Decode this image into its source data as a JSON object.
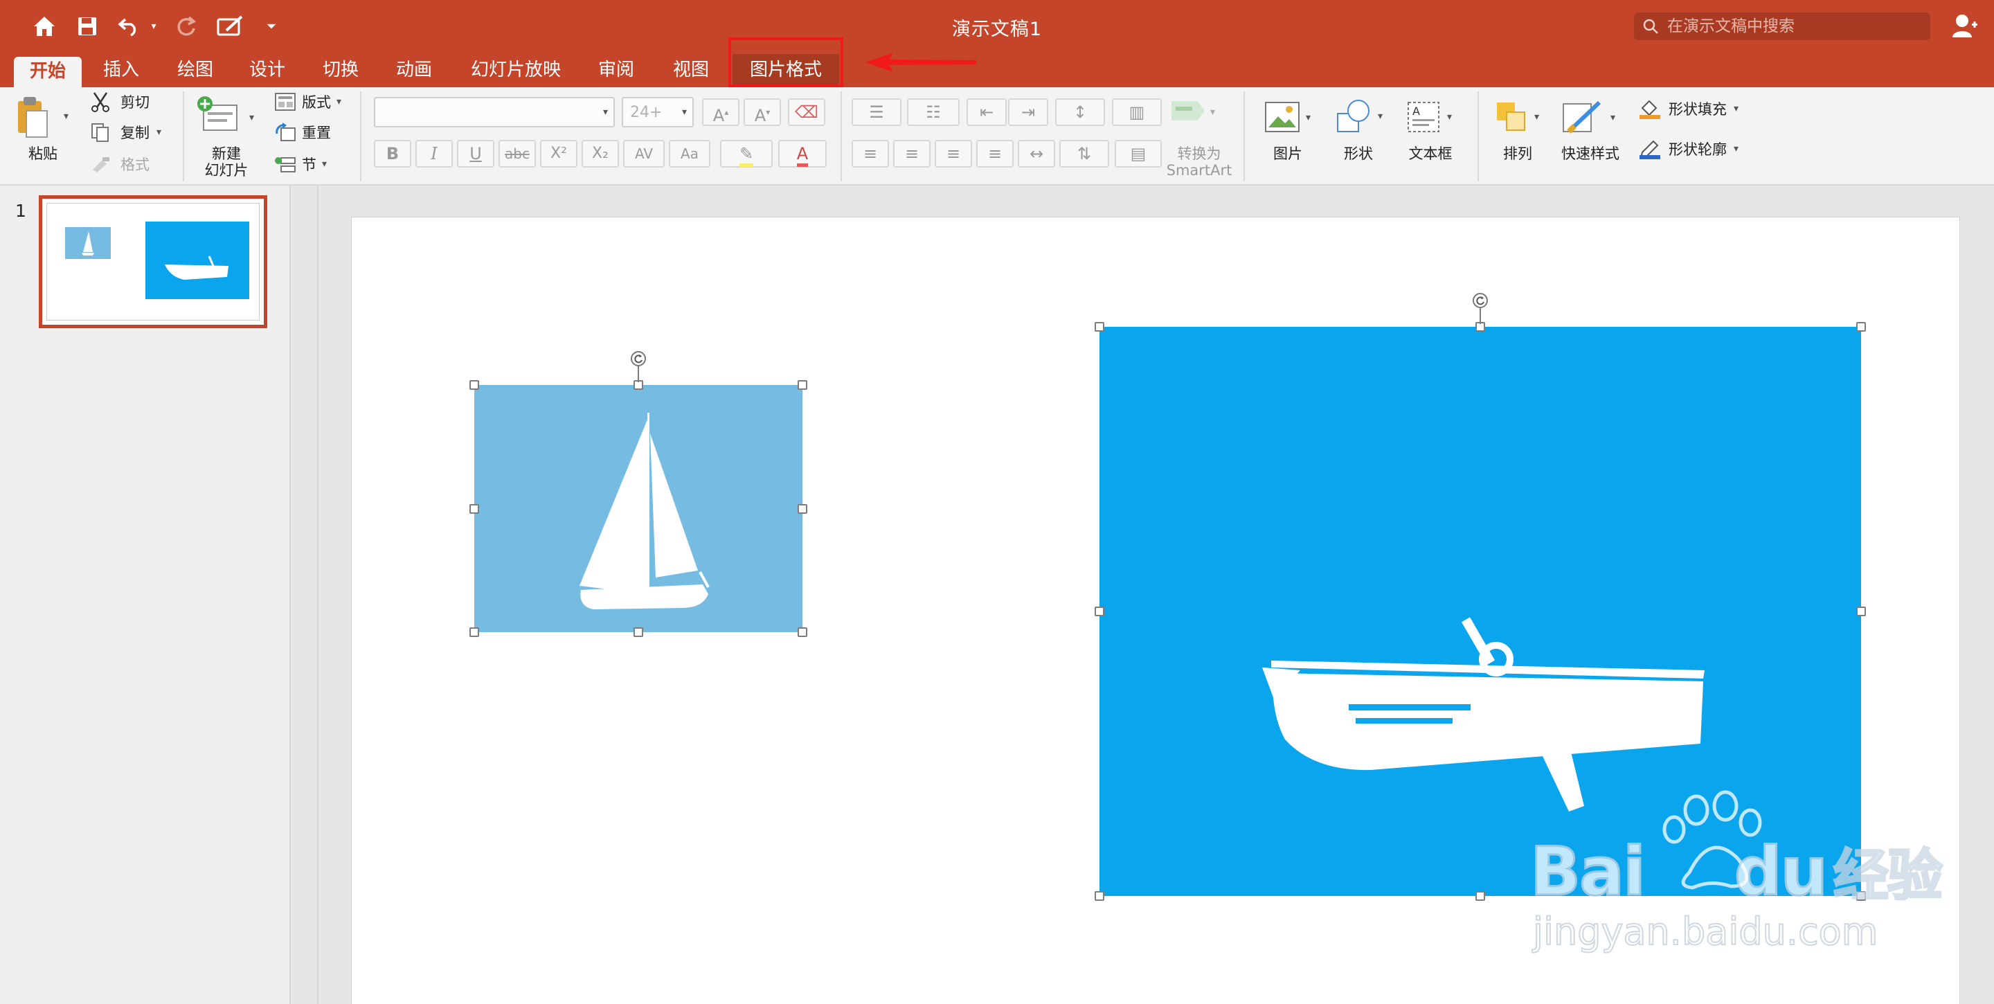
{
  "window": {
    "title": "演示文稿1"
  },
  "search": {
    "placeholder": "在演示文稿中搜索"
  },
  "tabs": [
    "开始",
    "插入",
    "绘图",
    "设计",
    "切换",
    "动画",
    "幻灯片放映",
    "审阅",
    "视图",
    "图片格式"
  ],
  "share_label": "共享",
  "clipboard": {
    "paste": "粘贴",
    "cut": "剪切",
    "copy": "复制",
    "format": "格式"
  },
  "slides_group": {
    "new_slide_l1": "新建",
    "new_slide_l2": "幻灯片",
    "layout": "版式",
    "reset": "重置",
    "section": "节"
  },
  "font": {
    "name_value": "",
    "size_placeholder": "24+"
  },
  "convert": {
    "line1": "转换为",
    "line2": "SmartArt"
  },
  "insert_group": {
    "picture": "图片",
    "shape": "形状",
    "textbox": "文本框"
  },
  "arrange_group": {
    "arrange": "排列",
    "quick_styles": "快速样式",
    "shape_fill": "形状填充",
    "shape_outline": "形状轮廓"
  },
  "thumbnails": [
    {
      "number": "1"
    }
  ],
  "watermark": {
    "brand": "Bai",
    "brand2": "du",
    "cn": "经验",
    "url": "jingyan.baidu.com"
  },
  "colors": {
    "accent": "#c4452a",
    "highlight": "#f11a1a",
    "light_blue": "#75bbe2",
    "bright_blue": "#0aa5ec"
  }
}
